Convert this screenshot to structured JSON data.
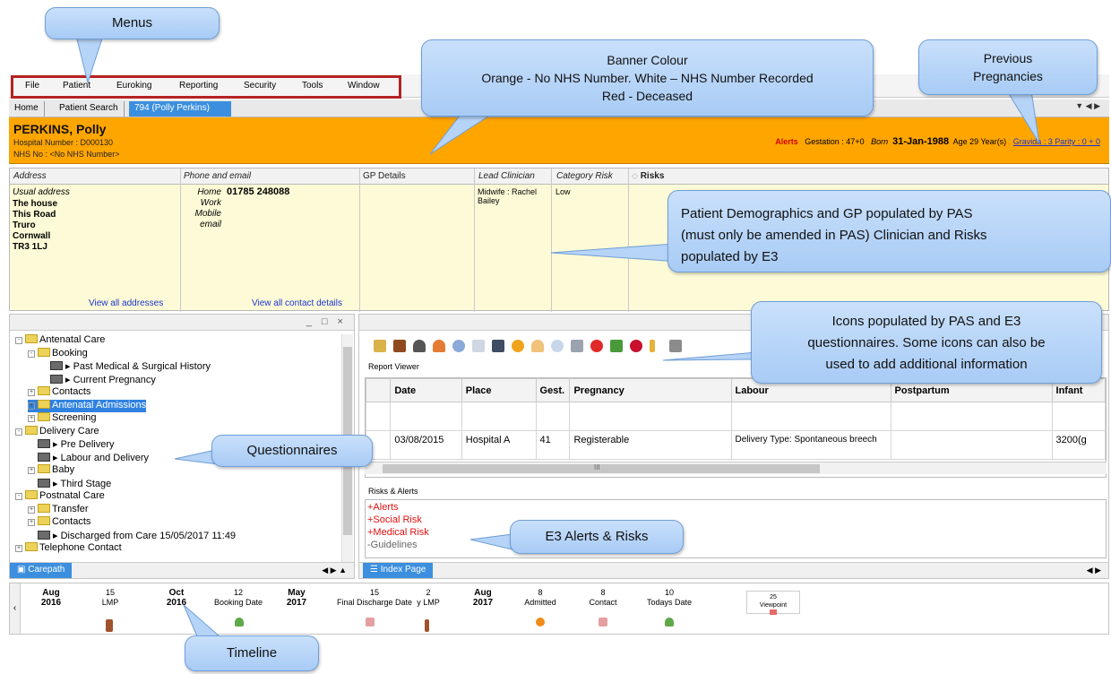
{
  "menu": {
    "items": [
      "File",
      "Patient",
      "Euroking",
      "Reporting",
      "Security",
      "Tools",
      "Window"
    ]
  },
  "tabs": {
    "home": "Home",
    "patient_search": "Patient Search",
    "active": "794 (Polly Perkins)"
  },
  "banner": {
    "color": "#ffa500",
    "name": "PERKINS, Polly",
    "hospital_number": "Hospital Number : D000130",
    "nhs_no": "NHS No : <No NHS Number>",
    "alerts": "Alerts",
    "gestation": "Gestation : 47+0",
    "born_label": "Born",
    "born_date": "31-Jan-1988",
    "age": "Age 29 Year(s)",
    "gravida_parity": "Gravida : 3 Parity : 0 + 0"
  },
  "demographics": {
    "headers": {
      "address": "Address",
      "phone_email": "Phone and email",
      "gp": "GP Details",
      "clinician": "Lead Clinician",
      "category": "Category Risk",
      "risks": "Risks"
    },
    "address_label": "Usual address",
    "address_lines": [
      "The house",
      "This Road",
      "Truro",
      "Cornwall",
      "TR3 1LJ"
    ],
    "contact_labels": [
      "Home",
      "Work",
      "Mobile",
      "email"
    ],
    "home_phone": "01785 248088",
    "clinician": "Midwife : Rachel Bailey",
    "category_risk": "Low",
    "view_addresses": "View all addresses",
    "view_contacts": "View all contact details"
  },
  "tree": {
    "items": [
      {
        "label": "Antenatal Care",
        "type": "folder",
        "level": 0,
        "expander": "-"
      },
      {
        "label": "Booking",
        "type": "folder",
        "level": 1,
        "expander": "-"
      },
      {
        "label": "Past Medical & Surgical History",
        "type": "form",
        "level": 2
      },
      {
        "label": "Current Pregnancy",
        "type": "form",
        "level": 2
      },
      {
        "label": "Contacts",
        "type": "folder",
        "level": 1,
        "expander": "+"
      },
      {
        "label": "Antenatal Admissions",
        "type": "folder",
        "level": 1,
        "expander": "+",
        "selected": true
      },
      {
        "label": "Screening",
        "type": "folder",
        "level": 1,
        "expander": "+"
      },
      {
        "label": "Delivery Care",
        "type": "folder",
        "level": 0,
        "expander": "-"
      },
      {
        "label": "Pre Delivery",
        "type": "form",
        "level": 1
      },
      {
        "label": "Labour and Delivery",
        "type": "form",
        "level": 1
      },
      {
        "label": "Baby",
        "type": "folder",
        "level": 1,
        "expander": "+"
      },
      {
        "label": "Third Stage",
        "type": "form",
        "level": 1
      },
      {
        "label": "Postnatal Care",
        "type": "folder",
        "level": 0,
        "expander": "-"
      },
      {
        "label": "Transfer",
        "type": "folder",
        "level": 1,
        "expander": "+"
      },
      {
        "label": "Contacts",
        "type": "folder",
        "level": 1,
        "expander": "+"
      },
      {
        "label": "Discharged from Care 15/05/2017 11:49",
        "type": "form",
        "level": 1
      },
      {
        "label": "Telephone Contact",
        "type": "folder",
        "level": 0,
        "expander": "+"
      }
    ]
  },
  "left_footer": {
    "carepath": "Carepath"
  },
  "report_viewer": {
    "label": "Report Viewer",
    "columns": [
      "Date",
      "Place",
      "Gest.",
      "Pregnancy",
      "Labour",
      "Postpartum",
      "Infant"
    ],
    "row": [
      "03/08/2015",
      "Hospital A",
      "41",
      "Registerable",
      "Delivery Type: Spontaneous breech",
      "",
      "3200(g"
    ],
    "scroll_mark": "III"
  },
  "risks_alerts": {
    "label": "Risks & Alerts",
    "items": [
      "+Alerts",
      "+Social Risk",
      "+Medical Risk",
      "-Guidelines"
    ],
    "colors": [
      "#e01010",
      "#e01010",
      "#e01010",
      "#666666"
    ]
  },
  "right_footer": {
    "index_page": "Index Page"
  },
  "timeline": {
    "months": [
      {
        "m": "Aug",
        "y": "2016"
      },
      {
        "m": "Oct",
        "y": "2016"
      },
      {
        "m": "May",
        "y": "2017"
      },
      {
        "m": "Aug",
        "y": "2017"
      }
    ],
    "events": [
      {
        "day": "15",
        "label": "LMP"
      },
      {
        "day": "12",
        "label": "Booking Date"
      },
      {
        "day": "15",
        "label": "Final Discharge Date"
      },
      {
        "day": "2",
        "label": "y LMP"
      },
      {
        "day": "8",
        "label": "Admitted"
      },
      {
        "day": "8",
        "label": "Contact"
      },
      {
        "day": "10",
        "label": "Todays Date"
      }
    ],
    "viewpoint_day": "25",
    "viewpoint_label": "Viewpoint"
  },
  "callouts": {
    "menus": "Menus",
    "banner": "Banner Colour\nOrange - No NHS Number. White – NHS Number Recorded\nRed - Deceased",
    "previous": "Previous\nPregnancies",
    "demographics": "Patient Demographics and GP populated by PAS\n(must only be amended in PAS) Clinician and Risks\npopulated by E3",
    "icons": "Icons populated by PAS and E3\nquestionnaires.  Some icons can also be\nused to add additional information",
    "questionnaires": "Questionnaires",
    "alerts_risks": "E3 Alerts & Risks",
    "timeline": "Timeline"
  }
}
